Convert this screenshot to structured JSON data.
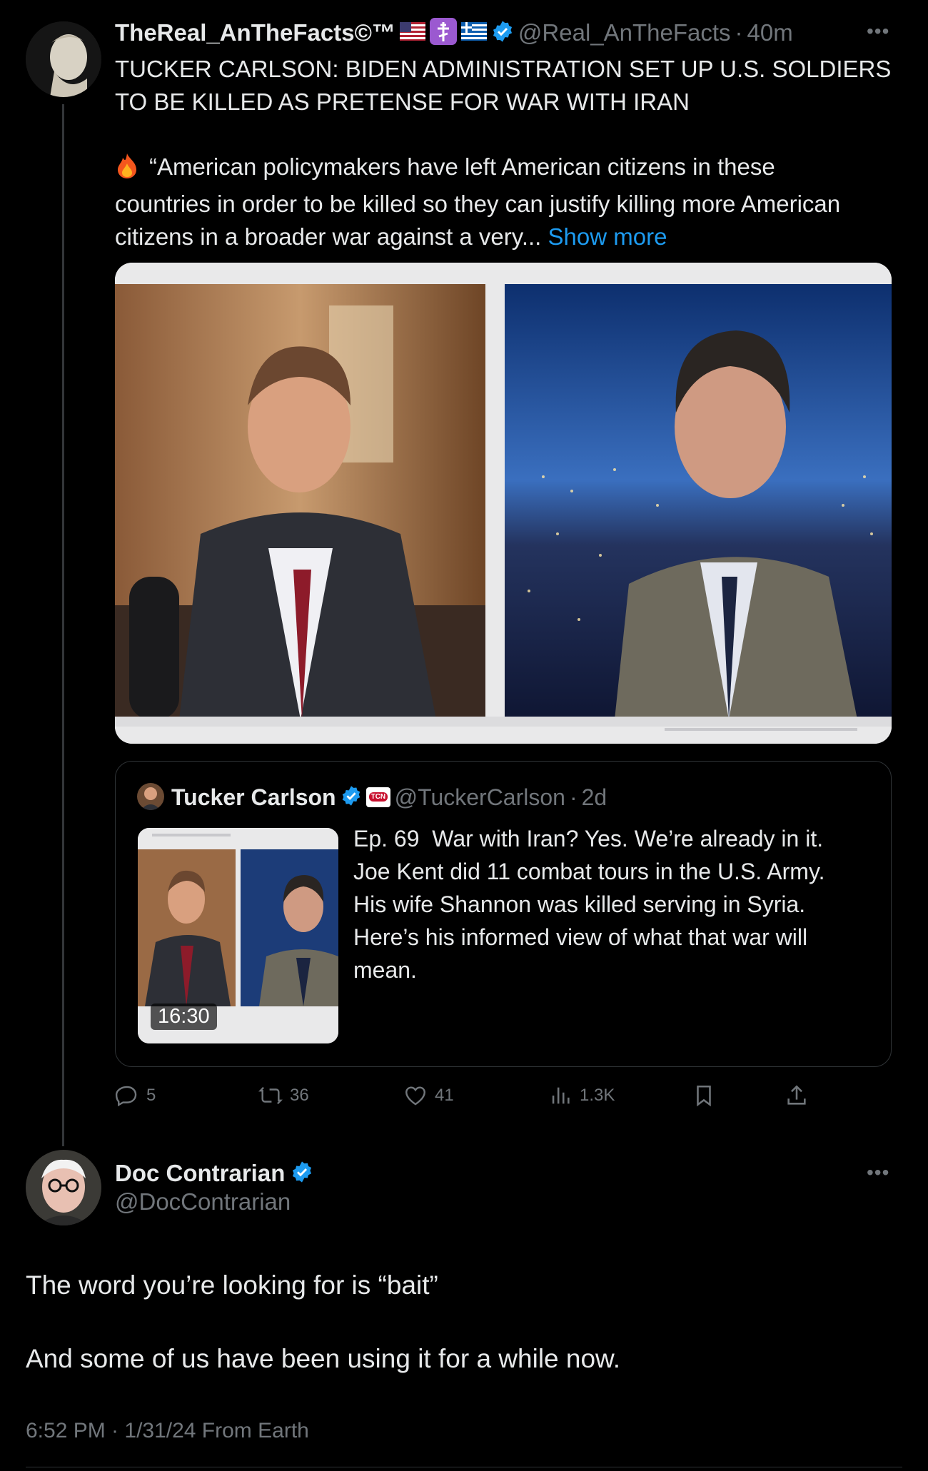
{
  "post": {
    "author_name": "TheReal_AnTheFacts©™",
    "author_handle": "@Real_AnTheFacts",
    "time": "40m",
    "headline_line1": "TUCKER CARLSON: BIDEN ADMINISTRATION SET UP U.S. SOLDIERS",
    "headline_line2": "TO BE KILLED AS PRETENSE FOR WAR WITH IRAN",
    "quote_line1": "“American policymakers have left American citizens in these",
    "quote_line2": "countries in order to be killed so they can justify killing more American",
    "quote_line3": "citizens in a broader war against a very...",
    "show_more": "Show more",
    "icons": [
      "fire-icon",
      "us-flag-icon",
      "orthodox-cross-icon",
      "greek-flag-icon",
      "verified-badge-icon"
    ]
  },
  "quoted": {
    "author_name": "Tucker Carlson",
    "author_handle": "@TuckerCarlson",
    "time": "2d",
    "text_line1": "Ep. 69  War with Iran? Yes. We’re already in it.",
    "text_line2": "Joe Kent did 11 combat tours in the U.S. Army.",
    "text_line3": "His wife Shannon was killed serving in Syria.",
    "text_line4": "Here’s his informed view of what that war will",
    "text_line5": "mean.",
    "video_duration": "16:30",
    "badge": "TCN"
  },
  "actions": {
    "replies": "5",
    "reposts": "36",
    "likes": "41",
    "views": "1.3K"
  },
  "reply": {
    "author_name": "Doc Contrarian",
    "author_handle": "@DocContrarian",
    "text_line1": "The word you’re looking for is “bait”",
    "text_line2": "And some of us have been using it for a while now.",
    "timestamp": "6:52 PM · 1/31/24 From Earth"
  },
  "colors": {
    "accent": "#1d9bf0",
    "muted": "#71767b",
    "text": "#e7e9ea",
    "background": "#000000"
  }
}
